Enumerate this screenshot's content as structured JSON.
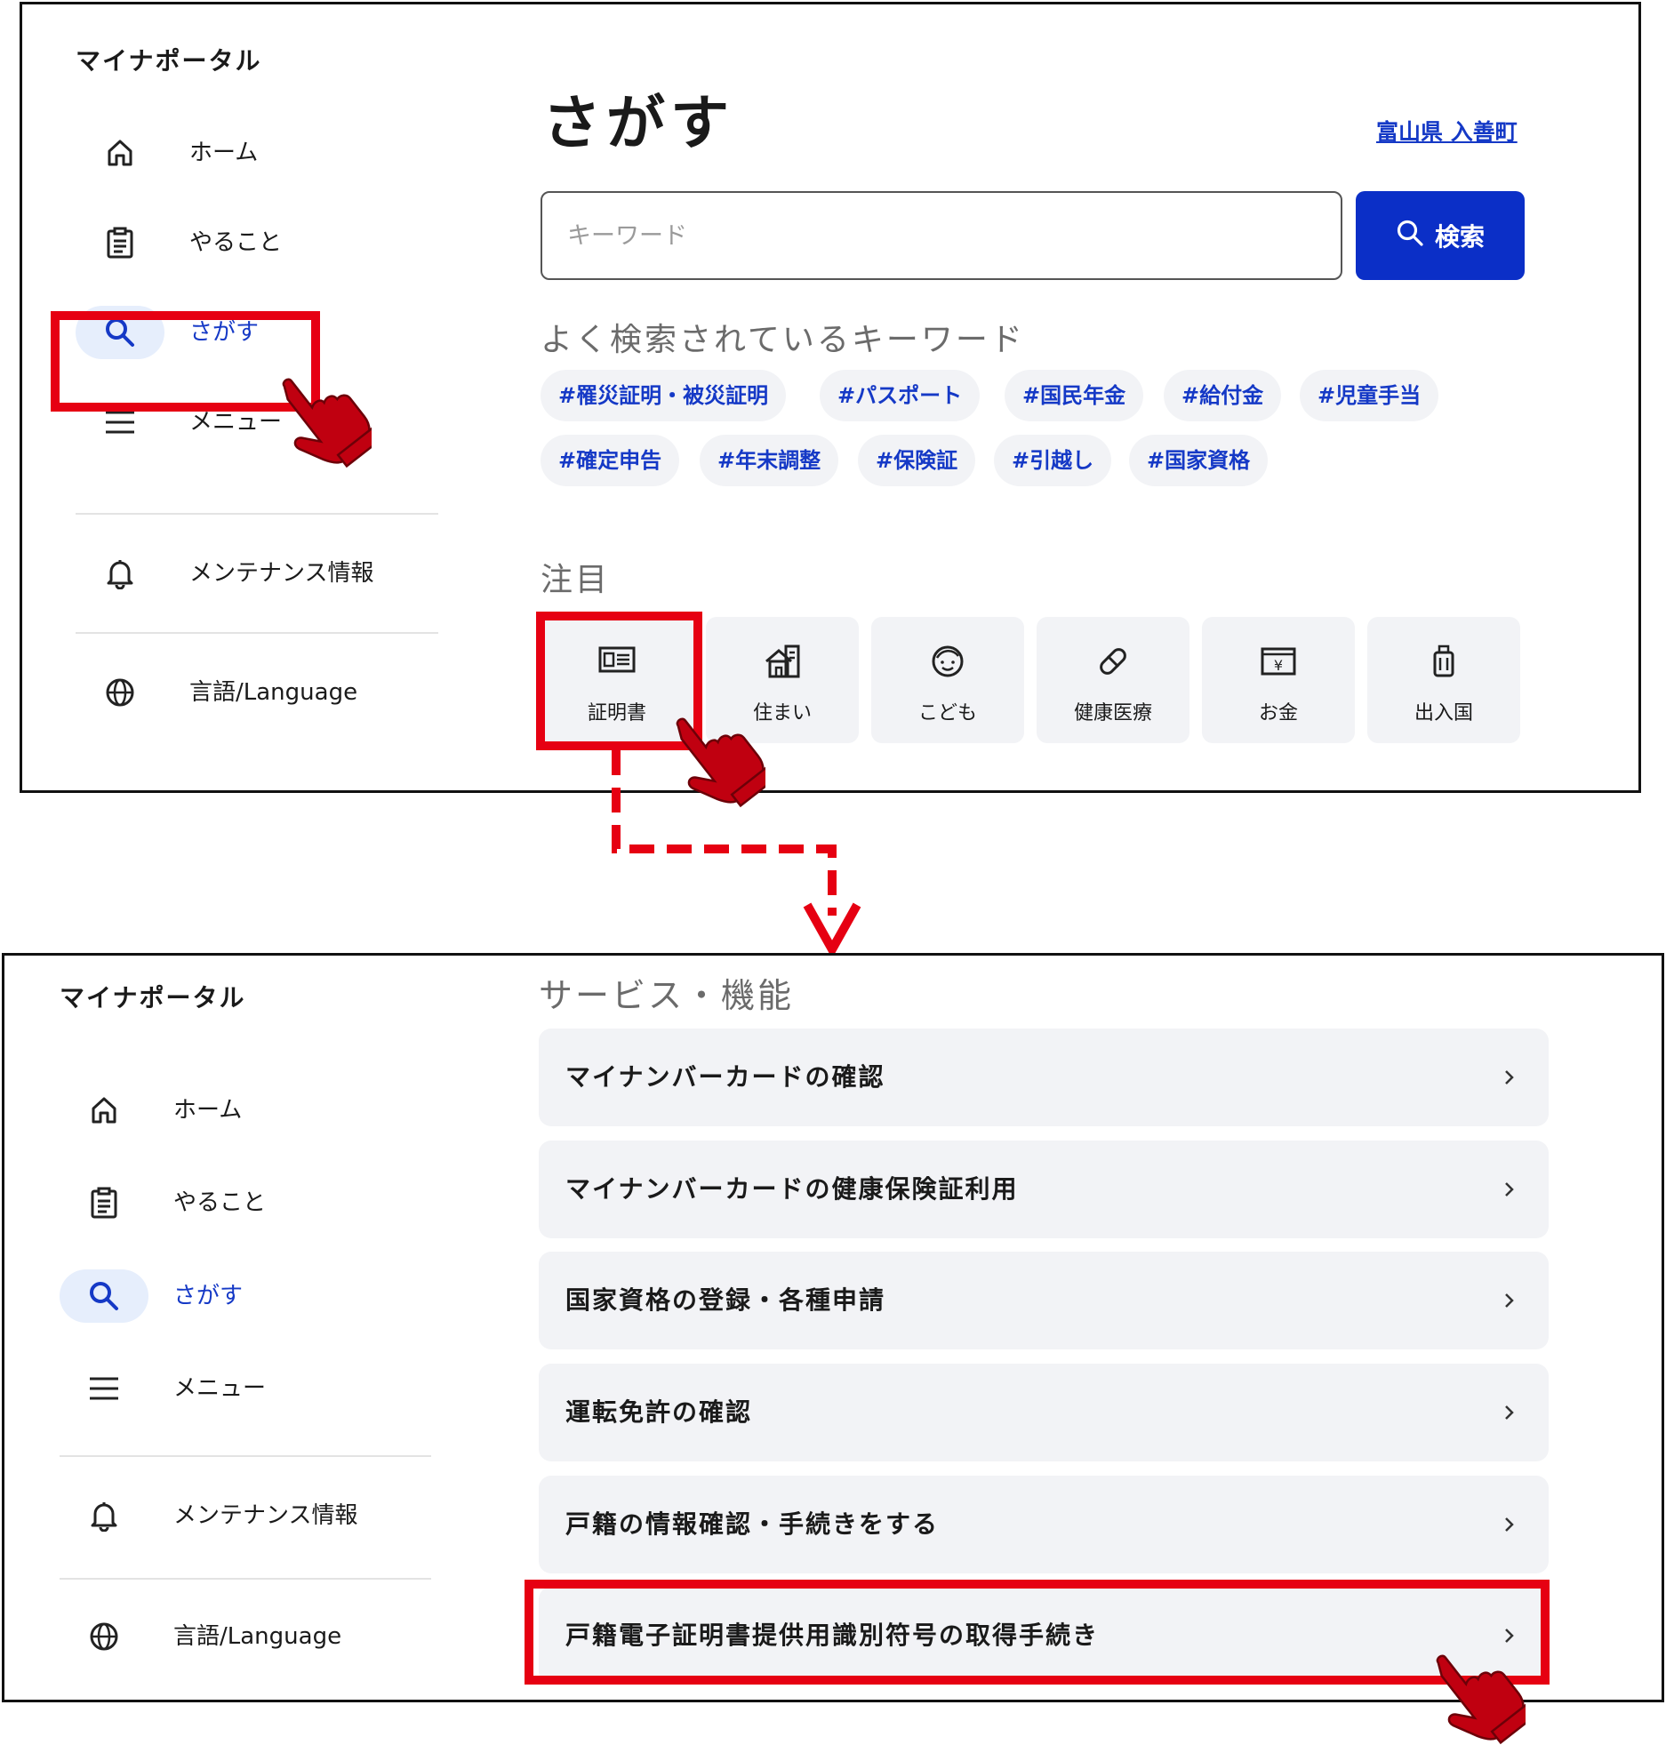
{
  "brand": "マイナポータル",
  "nav": {
    "home": "ホーム",
    "todo": "やること",
    "search": "さがす",
    "menu": "メニュー",
    "maintenance": "メンテナンス情報",
    "language": "言語/Language"
  },
  "search_page": {
    "title": "さがす",
    "region": "富山県 入善町",
    "placeholder": "キーワード",
    "search_button": "検索",
    "popular_heading": "よく検索されているキーワード",
    "keywords": [
      "#罹災証明・被災証明",
      "#パスポート",
      "#国民年金",
      "#給付金",
      "#児童手当",
      "#確定申告",
      "#年末調整",
      "#保険証",
      "#引越し",
      "#国家資格"
    ],
    "featured_heading": "注目",
    "categories": [
      {
        "label": "証明書",
        "icon": "certificate-icon"
      },
      {
        "label": "住まい",
        "icon": "house-icon"
      },
      {
        "label": "こども",
        "icon": "child-face-icon"
      },
      {
        "label": "健康医療",
        "icon": "pill-icon"
      },
      {
        "label": "お金",
        "icon": "money-icon"
      },
      {
        "label": "出入国",
        "icon": "suitcase-icon"
      }
    ]
  },
  "services": {
    "heading": "サービス・機能",
    "items": [
      "マイナンバーカードの確認",
      "マイナンバーカードの健康保険証利用",
      "国家資格の登録・各種申請",
      "運転免許の確認",
      "戸籍の情報確認・手続きをする",
      "戸籍電子証明書提供用識別符号の取得手続き"
    ]
  },
  "colors": {
    "accent": "#1539c6",
    "button": "#0b2fc7",
    "highlight": "#e60012",
    "hand": "#c00010",
    "tile": "#f2f3f6"
  }
}
